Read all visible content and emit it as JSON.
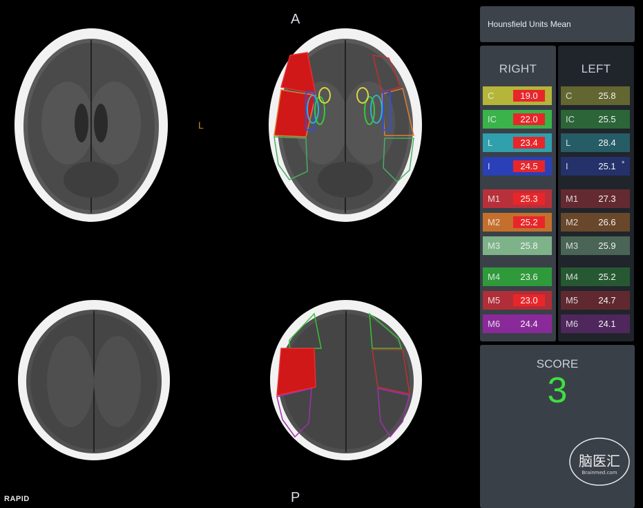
{
  "viewer": {
    "orientation": {
      "top": "A",
      "bottom": "P",
      "side": "L"
    },
    "brand": "RAPID"
  },
  "panel": {
    "title": "Hounsfield Units Mean",
    "right_header": "RIGHT",
    "left_header": "LEFT",
    "regions": [
      {
        "code": "C",
        "right": "19.0",
        "right_flag": true,
        "left": "25.8",
        "left_star": "",
        "color": "#b5b53a"
      },
      {
        "code": "IC",
        "right": "22.0",
        "right_flag": true,
        "left": "25.5",
        "left_star": "",
        "color": "#3ab34a"
      },
      {
        "code": "L",
        "right": "23.4",
        "right_flag": true,
        "left": "28.4",
        "left_star": "",
        "color": "#2fa0ac"
      },
      {
        "code": "I",
        "right": "24.5",
        "right_flag": true,
        "left": "25.1",
        "left_star": "*",
        "color": "#2a40b8"
      },
      {
        "code": "M1",
        "right": "25.3",
        "right_flag": true,
        "left": "27.3",
        "left_star": "",
        "color": "#b8303a"
      },
      {
        "code": "M2",
        "right": "25.2",
        "right_flag": true,
        "left": "26.6",
        "left_star": "",
        "color": "#c4702c"
      },
      {
        "code": "M3",
        "right": "25.8",
        "right_flag": false,
        "left": "25.9",
        "left_star": "",
        "color": "#7eb38a"
      },
      {
        "code": "M4",
        "right": "23.6",
        "right_flag": false,
        "left": "25.2",
        "left_star": "",
        "color": "#2e9a3a"
      },
      {
        "code": "M5",
        "right": "23.0",
        "right_flag": true,
        "left": "24.7",
        "left_star": "",
        "color": "#b02e38"
      },
      {
        "code": "M6",
        "right": "24.4",
        "right_flag": false,
        "left": "24.1",
        "left_star": "",
        "color": "#8a2a9a"
      }
    ]
  },
  "score": {
    "label": "SCORE",
    "value": "3",
    "color": "#3ee040"
  },
  "logo": {
    "text": "脑医汇",
    "subtext": "Brainmed.com"
  }
}
